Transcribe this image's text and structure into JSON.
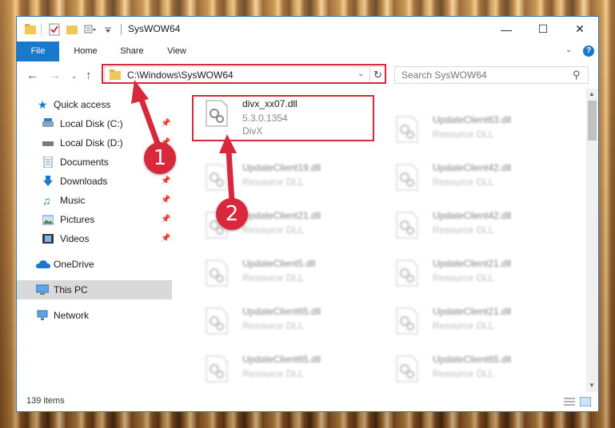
{
  "window": {
    "title": "SysWOW64",
    "controls": {
      "minimize": "—",
      "maximize": "☐",
      "close": "✕"
    }
  },
  "ribbon": {
    "tabs": [
      {
        "label": "File"
      },
      {
        "label": "Home"
      },
      {
        "label": "Share"
      },
      {
        "label": "View"
      }
    ],
    "help": "?"
  },
  "address": {
    "path": "C:\\Windows\\SysWOW64",
    "search_placeholder": "Search SysWOW64"
  },
  "sidebar": {
    "items": [
      {
        "label": "Quick access",
        "icon": "star-icon",
        "pinned": false
      },
      {
        "label": "Local Disk (C:)",
        "icon": "drive-icon",
        "pinned": true
      },
      {
        "label": "Local Disk (D:)",
        "icon": "drive-icon",
        "pinned": true
      },
      {
        "label": "Documents",
        "icon": "documents-icon",
        "pinned": true
      },
      {
        "label": "Downloads",
        "icon": "download-icon",
        "pinned": true
      },
      {
        "label": "Music",
        "icon": "music-icon",
        "pinned": true
      },
      {
        "label": "Pictures",
        "icon": "pictures-icon",
        "pinned": true
      },
      {
        "label": "Videos",
        "icon": "videos-icon",
        "pinned": true
      },
      {
        "label": "OneDrive",
        "icon": "onedrive-icon",
        "pinned": false
      },
      {
        "label": "This PC",
        "icon": "pc-icon",
        "pinned": false,
        "selected": true
      },
      {
        "label": "Network",
        "icon": "network-icon",
        "pinned": false
      }
    ]
  },
  "files": {
    "highlighted": {
      "name": "divx_xx07.dll",
      "version": "5.3.0.1354",
      "company": "DivX"
    },
    "col1": [
      {
        "name": "UpdateClient19.dll",
        "desc": "Resource DLL"
      },
      {
        "name": "UpdateClient21.dll",
        "desc": "Resource DLL"
      },
      {
        "name": "UpdateClient5.dll",
        "desc": "Resource DLL"
      },
      {
        "name": "UpdateClient65.dll",
        "desc": "Resource DLL"
      },
      {
        "name": "UpdateClient65.dll",
        "desc": "Resource DLL"
      }
    ],
    "col2": [
      {
        "name": "UpdateClient63.dll",
        "desc": "Resource DLL"
      },
      {
        "name": "UpdateClient42.dll",
        "desc": "Resource DLL"
      },
      {
        "name": "UpdateClient42.dll",
        "desc": "Resource DLL"
      },
      {
        "name": "UpdateClient21.dll",
        "desc": "Resource DLL"
      },
      {
        "name": "UpdateClient21.dll",
        "desc": "Resource DLL"
      },
      {
        "name": "UpdateClient65.dll",
        "desc": "Resource DLL"
      }
    ]
  },
  "status": {
    "count": "139 items"
  },
  "callouts": {
    "one": "1",
    "two": "2"
  },
  "colors": {
    "accent": "#1979ca",
    "highlight": "#d9283b",
    "selection": "#d9d9d9"
  }
}
